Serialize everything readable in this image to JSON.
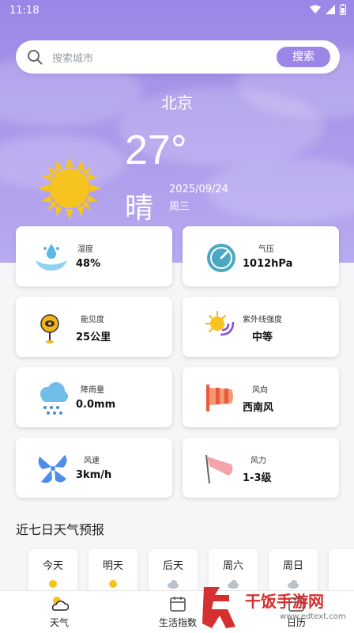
{
  "status": {
    "time": "11:18"
  },
  "search": {
    "placeholder": "搜索城市",
    "button": "搜索"
  },
  "weather": {
    "city": "北京",
    "temp": "27°",
    "condition": "晴",
    "date": "2025/09/24",
    "weekday": "周三"
  },
  "cards": [
    {
      "label": "湿度",
      "value": "48%",
      "icon": "humidity-icon"
    },
    {
      "label": "气压",
      "value": "1012hPa",
      "icon": "pressure-gauge-icon"
    },
    {
      "label": "能见度",
      "value": "25公里",
      "icon": "visibility-icon"
    },
    {
      "label": "紫外线强度",
      "value": "中等",
      "icon": "uv-sun-icon"
    },
    {
      "label": "降雨量",
      "value": "0.0mm",
      "icon": "rain-cloud-icon"
    },
    {
      "label": "风向",
      "value": "西南风",
      "icon": "wind-direction-icon"
    },
    {
      "label": "风速",
      "value": "3km/h",
      "icon": "fan-icon"
    },
    {
      "label": "风力",
      "value": "1-3级",
      "icon": "windsock-icon"
    }
  ],
  "forecast": {
    "title": "近七日天气预报",
    "days": [
      {
        "day": "今天",
        "icon": "sunny-icon"
      },
      {
        "day": "明天",
        "icon": "sunny-icon"
      },
      {
        "day": "后天",
        "icon": "cloudy-icon"
      },
      {
        "day": "周六",
        "icon": "cloudy-icon"
      },
      {
        "day": "周日",
        "icon": "cloudy-icon"
      }
    ]
  },
  "tabs": [
    {
      "label": "天气",
      "icon": "weather-icon"
    },
    {
      "label": "生活指数",
      "icon": "calendar-icon"
    },
    {
      "label": "日历",
      "icon": "calendar-icon"
    }
  ],
  "watermark": {
    "text": "干饭手游网",
    "url": "www.edtext.com"
  },
  "colors": {
    "accent": "#9c86e8",
    "hero": "#a896ea"
  }
}
